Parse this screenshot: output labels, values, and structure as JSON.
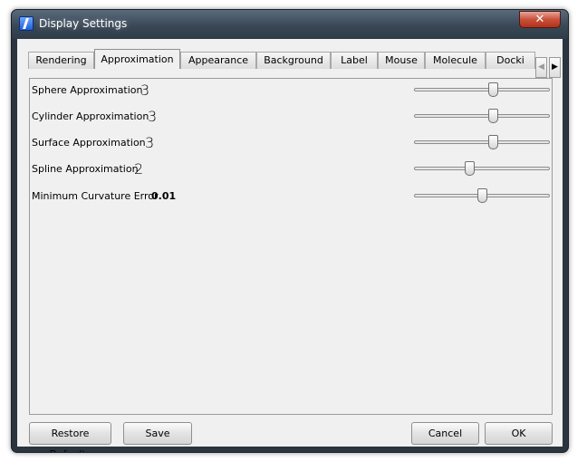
{
  "window": {
    "title": "Display Settings",
    "close_glyph": "✕",
    "icons": {
      "app": "app-icon",
      "close": "close-icon"
    }
  },
  "tabs": [
    {
      "label": "Rendering",
      "active": false
    },
    {
      "label": "Approximation",
      "active": true
    },
    {
      "label": "Appearance",
      "active": false
    },
    {
      "label": "Background",
      "active": false
    },
    {
      "label": "Label",
      "active": false
    },
    {
      "label": "Mouse",
      "active": false
    },
    {
      "label": "Molecule",
      "active": false
    },
    {
      "label": "Docki",
      "active": false
    }
  ],
  "tab_scroll": {
    "left_glyph": "◀",
    "right_glyph": "▶"
  },
  "settings": [
    {
      "label": "Sphere Approximation",
      "value": "3",
      "slider_fraction": 0.59
    },
    {
      "label": "Cylinder Approximation",
      "value": "3",
      "slider_fraction": 0.59
    },
    {
      "label": "Surface Approximation",
      "value": "3",
      "slider_fraction": 0.59
    },
    {
      "label": "Spline Approximation",
      "value": "2",
      "slider_fraction": 0.41
    },
    {
      "label": "Minimum Curvature Error",
      "value": "0.01",
      "slider_fraction": 0.51
    }
  ],
  "buttons": {
    "restore_defaults": "Restore Defaults",
    "save": "Save",
    "cancel": "Cancel",
    "ok": "OK"
  },
  "colors": {
    "frame": "#2b3540",
    "client": "#f0f0f0",
    "close_button": "#c9503a"
  }
}
